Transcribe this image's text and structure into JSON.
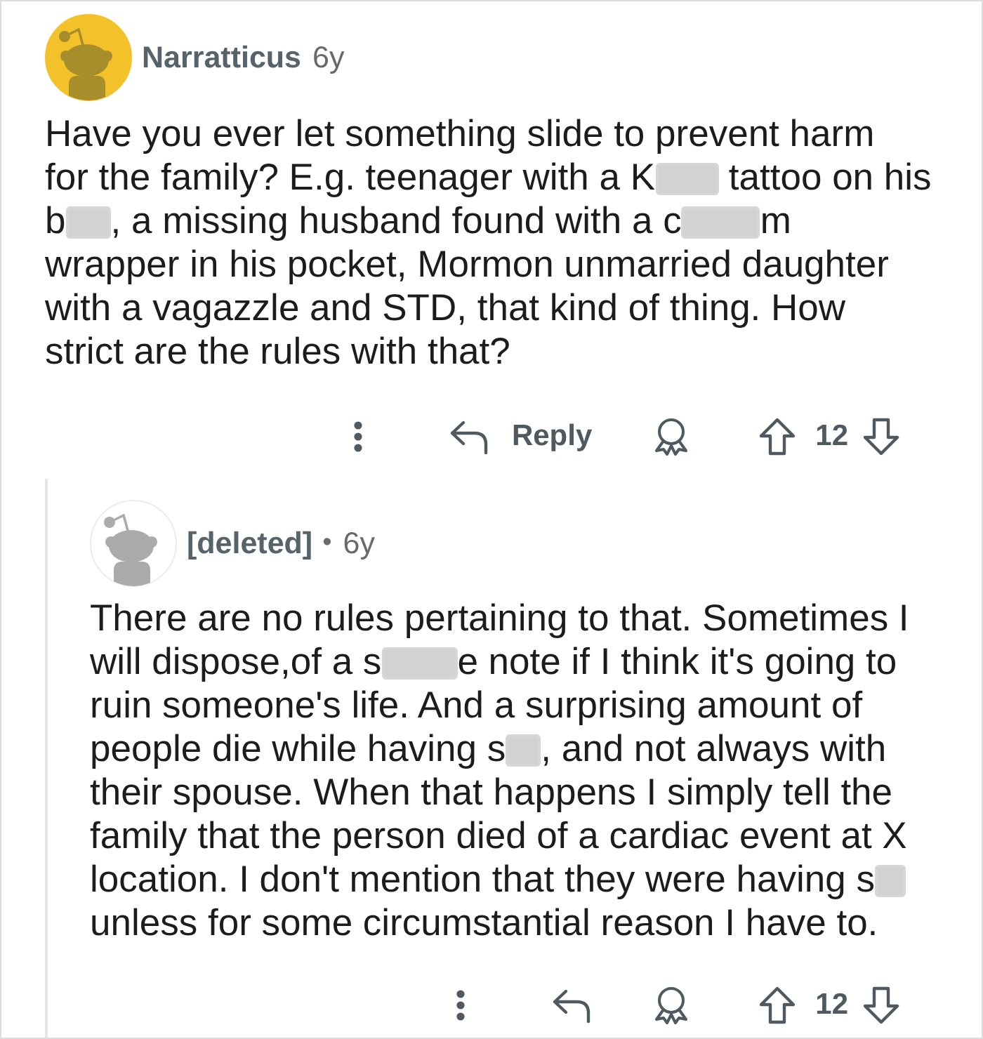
{
  "comments": [
    {
      "author": "Narratticus",
      "age": "6y",
      "deleted": false,
      "body": [
        [
          {
            "kind": "text",
            "text": "Have you ever let something slide to prevent harm"
          }
        ],
        [
          {
            "kind": "text",
            "text": "for the family? E.g. teenager with a K"
          },
          {
            "kind": "blur"
          },
          {
            "kind": "text",
            "text": " tattoo on his"
          }
        ],
        [
          {
            "kind": "text",
            "text": "b"
          },
          {
            "kind": "blur"
          },
          {
            "kind": "text",
            "text": ", a missing husband found with a c"
          },
          {
            "kind": "blur"
          },
          {
            "kind": "text",
            "text": "m"
          }
        ],
        [
          {
            "kind": "text",
            "text": "wrapper in his pocket, Mormon unmarried daughter"
          }
        ],
        [
          {
            "kind": "text",
            "text": "with a vagazzle and STD, that kind of thing. How"
          }
        ],
        [
          {
            "kind": "text",
            "text": "strict are the rules with that?"
          }
        ]
      ],
      "actions": {
        "reply_label": "Reply",
        "score": "12"
      },
      "replies": [
        {
          "author": "[deleted]",
          "separator": "•",
          "age": "6y",
          "deleted": true,
          "body": [
            [
              {
                "kind": "text",
                "text": "There are no rules pertaining to that. Sometimes I"
              }
            ],
            [
              {
                "kind": "text",
                "text": "will dispose,of a s"
              },
              {
                "kind": "blur"
              },
              {
                "kind": "text",
                "text": "e note if I think it's going to"
              }
            ],
            [
              {
                "kind": "text",
                "text": "ruin someone's life. And a surprising amount of"
              }
            ],
            [
              {
                "kind": "text",
                "text": "people die while having s"
              },
              {
                "kind": "blur"
              },
              {
                "kind": "text",
                "text": ", and not always with"
              }
            ],
            [
              {
                "kind": "text",
                "text": "their spouse. When that happens I simply tell the"
              }
            ],
            [
              {
                "kind": "text",
                "text": "family that the person died of a cardiac event at X"
              }
            ],
            [
              {
                "kind": "text",
                "text": "location. I don't mention that they were having s"
              },
              {
                "kind": "blur"
              }
            ],
            [
              {
                "kind": "text",
                "text": "unless for some circumstantial reason I have to."
              }
            ]
          ],
          "actions": {
            "score": "12"
          }
        }
      ]
    }
  ]
}
